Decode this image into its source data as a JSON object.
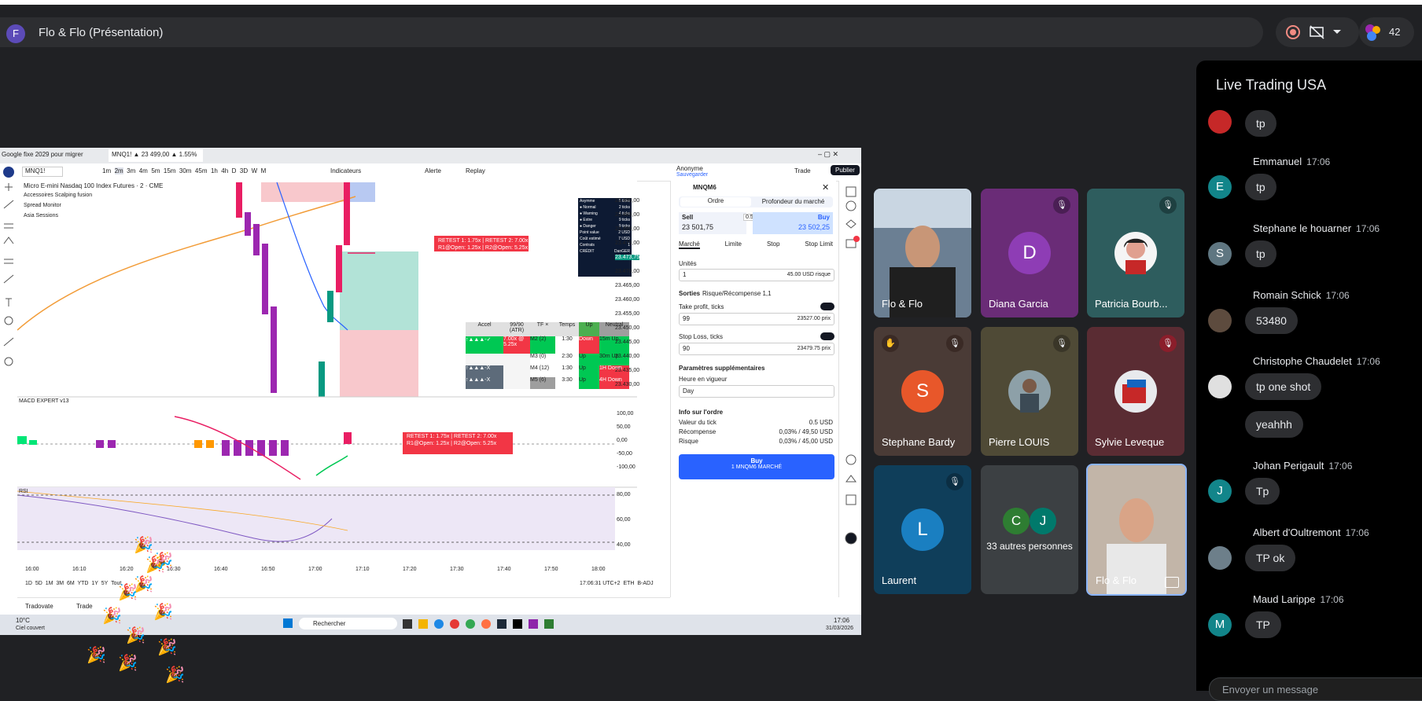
{
  "meeting": {
    "avatar_letter": "F",
    "title": "Flo & Flo (Présentation)",
    "participants_count": "42"
  },
  "screen": {
    "tabs": [
      "Google fixe 2029 pour migrer",
      "MNQ1! ▲ 23 499,00 ▲ 1.55%"
    ],
    "symbol": "MNQ1!",
    "timeframes": [
      "1m",
      "2m",
      "3m",
      "4m",
      "5m",
      "15m",
      "30m",
      "45m",
      "1h",
      "4h",
      "D",
      "3D",
      "W",
      "M"
    ],
    "toolbar": {
      "indicators": "Indicateurs",
      "alert": "Alerte",
      "replay": "Replay",
      "account": "Anonyme",
      "account_sub": "Sauvegarder",
      "trade": "Trade",
      "publish": "Publier"
    },
    "chart_title": "Micro E-mini Nasdaq 100 Index Futures · 2 · CME",
    "indicators": [
      "Accessoires Scalping fusion",
      "Spread Monitor",
      "Asia Sessions"
    ],
    "macd_label": "MACD EXPERT v13",
    "rsi_label": "RSI",
    "price_axis": [
      "23.490,00",
      "23.485,00",
      "23.480,00",
      "23.475,00",
      "23.470,00",
      "23.465,00",
      "23.460,00",
      "23.455,00",
      "23.450,00",
      "23.445,00",
      "23.440,00",
      "23.435,00",
      "23.430,00"
    ],
    "current_price": "23.473,75",
    "macd_axis": [
      "100,00",
      "50,00",
      "0,00",
      "-50,00",
      "-100,00"
    ],
    "rsi_axis": [
      "80,00",
      "60,00",
      "40,00"
    ],
    "time_axis": [
      "16:00",
      "16:10",
      "16:20",
      "16:30",
      "16:40",
      "16:50",
      "17:00",
      "17:10",
      "17:20",
      "17:30",
      "17:40",
      "17:50",
      "18:00"
    ],
    "ranges": [
      "1D",
      "5D",
      "1M",
      "3M",
      "6M",
      "YTD",
      "1Y",
      "5Y",
      "Tout"
    ],
    "clock": "17:06:31 UTC+2",
    "session": "ETH",
    "adj": "B-ADJ",
    "retest_box_1": "RETEST 1: 1.75x | RETEST 2: 7.00x",
    "retest_box_2": "R1@Open: 1.25x | R2@Open: 5.25x",
    "table_headers": [
      "Accel",
      "99/90 (ATR)",
      "TF ×",
      "Temps",
      "Up",
      "Neutral"
    ],
    "table_rows": [
      [
        "↑▲▲▲-✓",
        "7.00x @ 5.25x",
        "M2 (2)",
        "1:30",
        "Down",
        "15m Up"
      ],
      [
        "",
        "",
        "M3 (0)",
        "2:30",
        "Up",
        "30m Up"
      ],
      [
        "↑▲▲▲-X",
        "",
        "M4 (12)",
        "1:30",
        "Up",
        "1H Down"
      ],
      [
        "↑▲▲▲-X",
        "",
        "M5 (6)",
        "3:30",
        "Up",
        "4H Down"
      ]
    ],
    "status_table": [
      [
        "Asymme",
        "5 ticks"
      ],
      [
        "● Normal",
        "2 ticks"
      ],
      [
        "● Warning",
        "4 ticks"
      ],
      [
        "● Extre",
        "9 ticks"
      ],
      [
        "● Danger",
        "9 ticks"
      ],
      [
        "Point value",
        "2 USD"
      ],
      [
        "Coût estimé",
        "7 USD"
      ],
      [
        "Contrats",
        "1"
      ],
      [
        "CRÉDIT",
        "DanGER"
      ]
    ],
    "order": {
      "symbol": "MNQM6",
      "tab_order": "Ordre",
      "tab_depth": "Profondeur du marché",
      "sell_label": "Sell",
      "sell_price": "23 501,75",
      "spread": "0.50",
      "buy_label": "Buy",
      "buy_price": "23 502,25",
      "types": [
        "Marché",
        "Limite",
        "Stop",
        "Stop Limit"
      ],
      "units_label": "Unités",
      "units_value": "1",
      "units_risk": "45.00 USD risque",
      "exits_label": "Sorties",
      "exits_sub": "Risque/Récompense 1,1",
      "tp_label": "Take profit, ticks",
      "tp_value": "99",
      "tp_price": "23527.00 prix",
      "sl_label": "Stop Loss, ticks",
      "sl_value": "90",
      "sl_price": "23479.75 prix",
      "extra_label": "Paramètres supplémentaires",
      "tif_label": "Heure en vigueur",
      "tif_value": "Day",
      "info_label": "Info sur l'ordre",
      "info_rows": [
        [
          "Valeur du tick",
          "0.5 USD"
        ],
        [
          "Récompense",
          "0,03% / 49,50 USD"
        ],
        [
          "Risque",
          "0,03% / 45,00 USD"
        ]
      ],
      "buy_button": "Buy",
      "buy_button_sub": "1 MNQM6 MARCHÉ"
    },
    "bottom_tabs": [
      "Tradovate",
      "Trade"
    ],
    "taskbar": {
      "weather": "10°C",
      "weather_sub": "Ciel couvert",
      "search": "Rechercher",
      "time": "17:06",
      "date": "31/03/2026"
    }
  },
  "tiles": [
    {
      "name": "Flo & Flo",
      "type": "video"
    },
    {
      "name": "Diana Garcia",
      "letter": "D",
      "bg": "#6a2c77",
      "avatar": "#8e3db5",
      "muted": true
    },
    {
      "name": "Patricia Bourb...",
      "bg": "#2e5d5e",
      "muted": true
    },
    {
      "name": "Stephane Bardy",
      "letter": "S",
      "bg": "#4a3b36",
      "avatar": "#e8572a",
      "muted": true
    },
    {
      "name": "Pierre LOUIS",
      "bg": "#4f4a36",
      "muted": true
    },
    {
      "name": "Sylvie Leveque",
      "bg": "#5a2c33",
      "muted": true
    },
    {
      "name": "Laurent",
      "letter": "L",
      "bg": "#0f3e5a",
      "avatar": "#1a7fc1",
      "muted": true
    },
    {
      "name": "33 autres personnes",
      "letters": [
        "C",
        "J"
      ],
      "bg": "#3c4043"
    },
    {
      "name": "Flo & Flo",
      "type": "video"
    }
  ],
  "chat": {
    "title": "Live Trading USA",
    "messages": [
      {
        "author": "",
        "time": "",
        "text": "tp"
      },
      {
        "author": "Emmanuel",
        "time": "17:06",
        "text": "tp",
        "letter": "E",
        "color": "#12858a"
      },
      {
        "author": "Stephane le houarner",
        "time": "17:06",
        "text": "tp",
        "letter": "S",
        "color": "#5f7681"
      },
      {
        "author": "Romain Schick",
        "time": "17:06",
        "text": "53480"
      },
      {
        "author": "Christophe Chaudelet",
        "time": "17:06",
        "text": "tp one shot",
        "text2": "yeahhh"
      },
      {
        "author": "Johan Perigault",
        "time": "17:06",
        "text": "Tp",
        "letter": "J",
        "color": "#12858a"
      },
      {
        "author": "Albert d'Oultremont",
        "time": "17:06",
        "text": "TP ok"
      },
      {
        "author": "Maud Larippe",
        "time": "17:06",
        "text": "TP",
        "letter": "M",
        "color": "#12858a"
      }
    ],
    "input_placeholder": "Envoyer un message"
  }
}
